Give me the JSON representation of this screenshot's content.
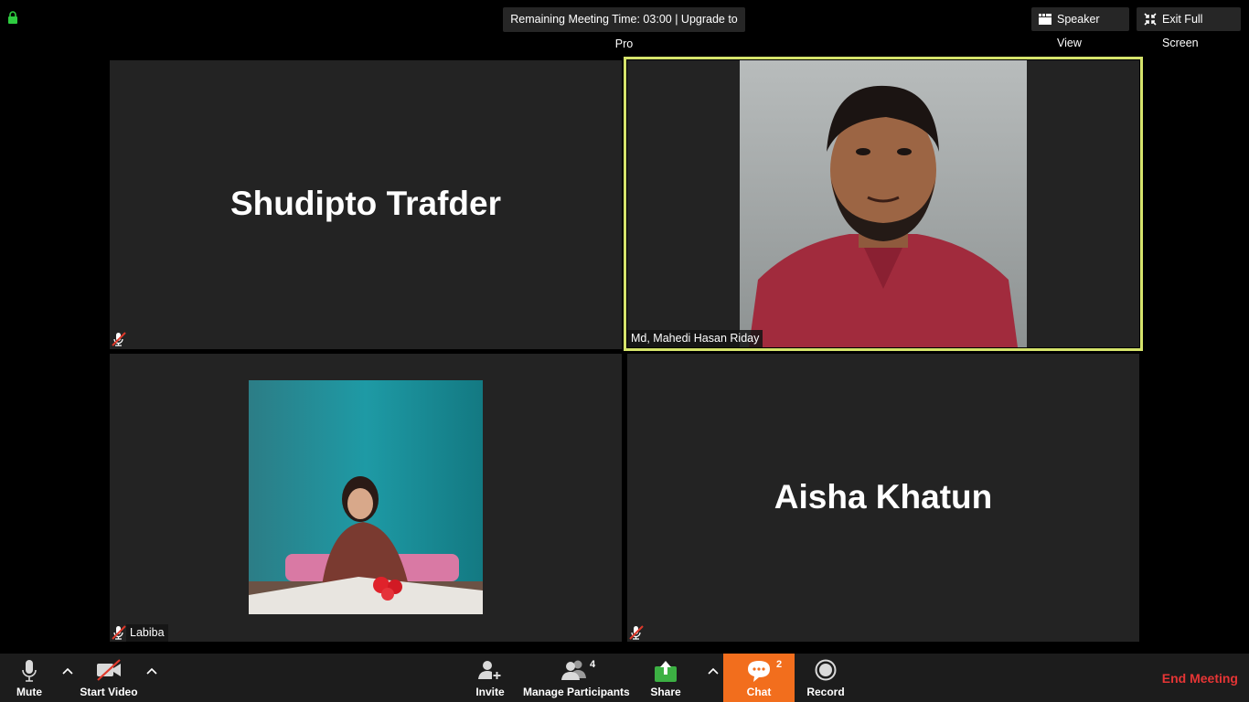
{
  "topbar": {
    "meeting_time": "Remaining Meeting Time: 03:00 | Upgrade to Pro",
    "speaker_view": "Speaker View",
    "exit_full_screen": "Exit Full Screen"
  },
  "participants": [
    {
      "name": "Shudipto Trafder",
      "video": false,
      "muted": true
    },
    {
      "name": "Md, Mahedi Hasan Riday",
      "video": true,
      "active_speaker": true
    },
    {
      "name": "Labiba",
      "video": true,
      "muted": true
    },
    {
      "name": "Aisha Khatun",
      "video": false,
      "muted": true
    }
  ],
  "toolbar": {
    "mute": "Mute",
    "start_video": "Start Video",
    "invite": "Invite",
    "manage_participants": "Manage Participants",
    "participant_count": "4",
    "share": "Share",
    "chat": "Chat",
    "chat_count": "2",
    "record": "Record",
    "end_meeting": "End Meeting"
  },
  "colors": {
    "active_speaker_border": "#d5e36b",
    "chat_active": "#f26e1d",
    "end_meeting": "#e53535",
    "share_icon": "#3cb043",
    "lock_icon": "#2ecc40"
  }
}
